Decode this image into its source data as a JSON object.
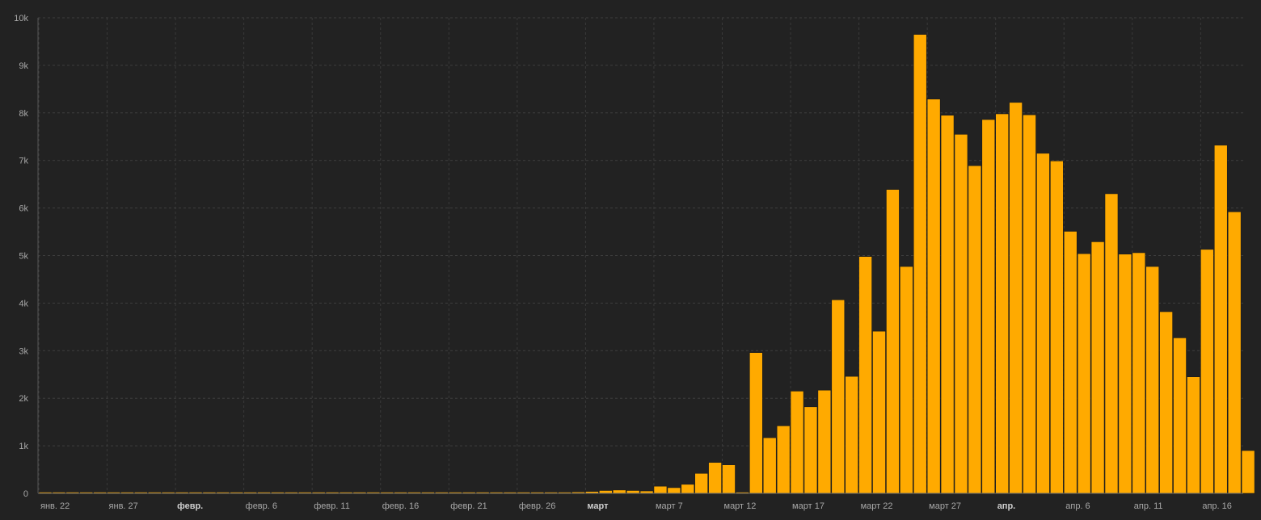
{
  "chart_data": {
    "type": "bar",
    "title": "",
    "xlabel": "",
    "ylabel": "",
    "ylim": [
      0,
      10000
    ],
    "grid": true,
    "legend": "none",
    "bar_color": "#FFAA00",
    "background": "#222222",
    "y_ticks": [
      {
        "value": 0,
        "label": "0"
      },
      {
        "value": 1000,
        "label": "1k"
      },
      {
        "value": 2000,
        "label": "2k"
      },
      {
        "value": 3000,
        "label": "3k"
      },
      {
        "value": 4000,
        "label": "4k"
      },
      {
        "value": 5000,
        "label": "5k"
      },
      {
        "value": 6000,
        "label": "6k"
      },
      {
        "value": 7000,
        "label": "7k"
      },
      {
        "value": 8000,
        "label": "8k"
      },
      {
        "value": 9000,
        "label": "9k"
      },
      {
        "value": 10000,
        "label": "10k"
      }
    ],
    "x_ticks": [
      {
        "index": 0,
        "label": "янв. 22",
        "bold": false
      },
      {
        "index": 5,
        "label": "янв. 27",
        "bold": false
      },
      {
        "index": 10,
        "label": "февр.",
        "bold": true
      },
      {
        "index": 15,
        "label": "февр. 6",
        "bold": false
      },
      {
        "index": 20,
        "label": "февр. 11",
        "bold": false
      },
      {
        "index": 25,
        "label": "февр. 16",
        "bold": false
      },
      {
        "index": 30,
        "label": "февр. 21",
        "bold": false
      },
      {
        "index": 35,
        "label": "февр. 26",
        "bold": false
      },
      {
        "index": 40,
        "label": "март",
        "bold": true
      },
      {
        "index": 45,
        "label": "март 7",
        "bold": false
      },
      {
        "index": 50,
        "label": "март 12",
        "bold": false
      },
      {
        "index": 55,
        "label": "март 17",
        "bold": false
      },
      {
        "index": 60,
        "label": "март 22",
        "bold": false
      },
      {
        "index": 65,
        "label": "март 27",
        "bold": false
      },
      {
        "index": 70,
        "label": "апр.",
        "bold": true
      },
      {
        "index": 75,
        "label": "апр. 6",
        "bold": false
      },
      {
        "index": 80,
        "label": "апр. 11",
        "bold": false
      },
      {
        "index": 85,
        "label": "апр. 16",
        "bold": false
      }
    ],
    "values": [
      0,
      0,
      0,
      0,
      0,
      0,
      0,
      0,
      0,
      0,
      0,
      0,
      0,
      0,
      0,
      0,
      0,
      0,
      0,
      0,
      0,
      0,
      0,
      0,
      0,
      0,
      0,
      0,
      0,
      0,
      0,
      0,
      0,
      0,
      0,
      0,
      0,
      10,
      20,
      30,
      40,
      60,
      70,
      60,
      50,
      150,
      120,
      190,
      420,
      650,
      600,
      0,
      2960,
      1170,
      1420,
      2150,
      1820,
      2170,
      4070,
      2460,
      4980,
      3410,
      6390,
      4770,
      9650,
      8290,
      7950,
      7550,
      6890,
      7860,
      7980,
      8220,
      7960,
      7150,
      6990,
      5510,
      5040,
      5290,
      6300,
      5030,
      5060,
      4770,
      3820,
      3270,
      2450,
      5130,
      7320,
      5920,
      900
    ]
  }
}
